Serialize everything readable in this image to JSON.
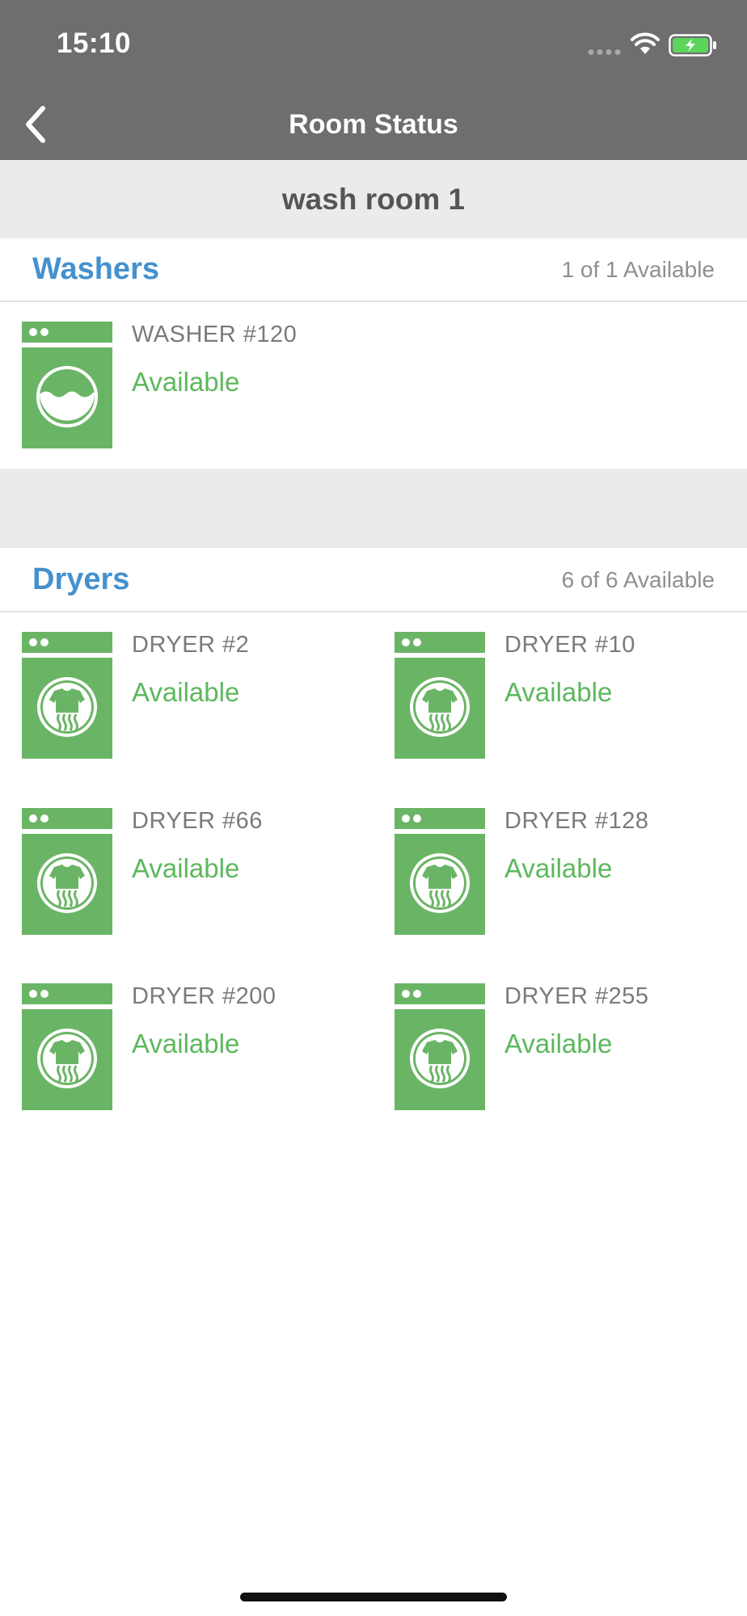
{
  "status_bar": {
    "time": "15:10"
  },
  "nav": {
    "title": "Room Status",
    "back_icon": "chevron-left-icon"
  },
  "room": {
    "name": "wash room 1"
  },
  "washers": {
    "title": "Washers",
    "count": "1 of 1 Available",
    "items": [
      {
        "name": "WASHER #120",
        "status": "Available",
        "icon": "washer-icon"
      }
    ]
  },
  "dryers": {
    "title": "Dryers",
    "count": "6 of 6 Available",
    "items": [
      {
        "name": "DRYER #2",
        "status": "Available",
        "icon": "dryer-icon"
      },
      {
        "name": "DRYER #10",
        "status": "Available",
        "icon": "dryer-icon"
      },
      {
        "name": "DRYER #66",
        "status": "Available",
        "icon": "dryer-icon"
      },
      {
        "name": "DRYER #128",
        "status": "Available",
        "icon": "dryer-icon"
      },
      {
        "name": "DRYER #200",
        "status": "Available",
        "icon": "dryer-icon"
      },
      {
        "name": "DRYER #255",
        "status": "Available",
        "icon": "dryer-icon"
      }
    ]
  },
  "colors": {
    "header_bg": "#6e6e70",
    "section_title": "#4491cf",
    "available": "#5cb85c",
    "machine_icon": "#6ab565"
  }
}
